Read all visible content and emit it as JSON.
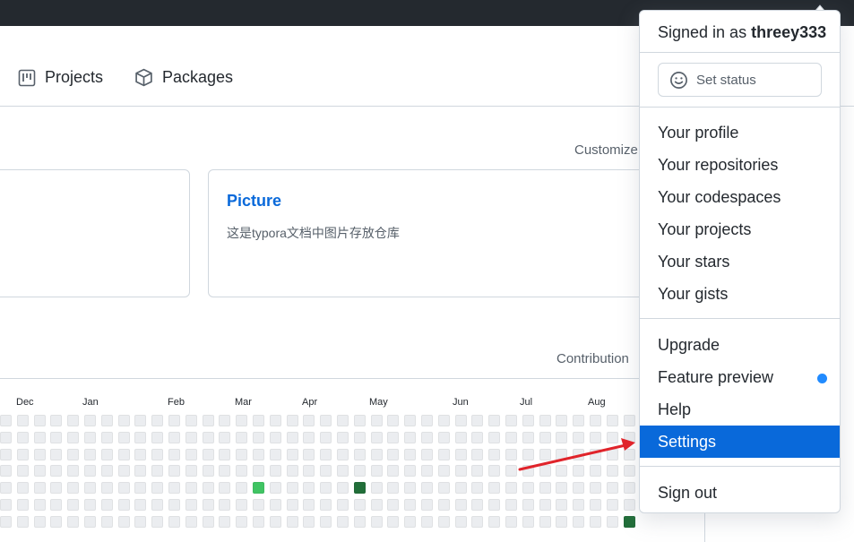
{
  "tabs": [
    {
      "label": "Projects",
      "icon": "project-board-icon"
    },
    {
      "label": "Packages",
      "icon": "package-icon"
    }
  ],
  "customize": "Customize",
  "cards": {
    "right_title": "Picture",
    "right_desc": "这是typora文档中图片存放仓库"
  },
  "contributions": {
    "label": "Contribution",
    "months": [
      "Dec",
      "Jan",
      "Feb",
      "Mar",
      "Apr",
      "May",
      "Jun",
      "Jul",
      "Aug"
    ],
    "colors": {
      "empty": "#ebedf0",
      "light": "#40c463",
      "dark": "#216e39"
    }
  },
  "menu": {
    "signed_prefix": "Signed in as ",
    "username": "threey333",
    "set_status": "Set status",
    "items_group1": [
      "Your profile",
      "Your repositories",
      "Your codespaces",
      "Your projects",
      "Your stars",
      "Your gists"
    ],
    "items_group2": [
      "Upgrade",
      "Feature preview",
      "Help",
      "Settings"
    ],
    "sign_out": "Sign out",
    "active_item": "Settings",
    "accent": "#0969da",
    "dot_color": "#218bff"
  },
  "annotation": {
    "arrow_color": "#e0242b"
  }
}
